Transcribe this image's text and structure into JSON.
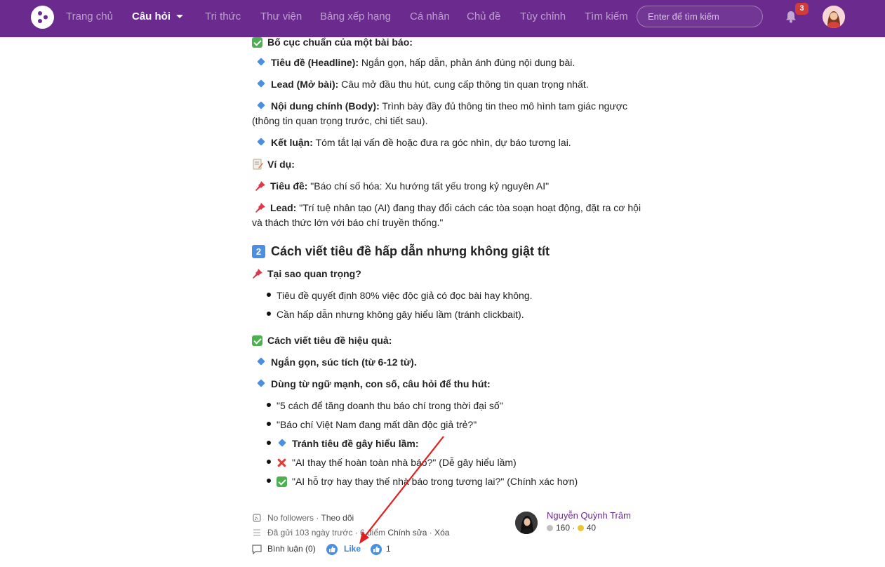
{
  "nav": {
    "items": [
      "Trang chủ",
      "Câu hỏi",
      "Tri thức",
      "Thư viện",
      "Bảng xếp hạng",
      "Cá nhân",
      "Chủ đề",
      "Tùy chỉnh",
      "Tìm kiếm"
    ],
    "active": "Câu hỏi",
    "search_placeholder": "Enter để tìm kiếm",
    "notification_count": "3"
  },
  "article": {
    "structure_heading": "Bố cục chuẩn của một bài báo:",
    "structure_items": [
      {
        "label": "Tiêu đề (Headline):",
        "text": " Ngắn gọn, hấp dẫn, phản ánh đúng nội dung bài."
      },
      {
        "label": "Lead (Mở bài):",
        "text": " Câu mở đầu thu hút, cung cấp thông tin quan trọng nhất."
      },
      {
        "label": "Nội dung chính (Body):",
        "text": " Trình bày đầy đủ thông tin theo mô hình tam giác ngược (thông tin quan trọng trước, chi tiết sau)."
      },
      {
        "label": "Kết luận:",
        "text": " Tóm tắt lại vấn đề hoặc đưa ra góc nhìn, dự báo tương lai."
      }
    ],
    "example_heading": "Ví dụ:",
    "example_items": [
      {
        "label": "Tiêu đề:",
        "text": " \"Báo chí số hóa: Xu hướng tất yếu trong kỷ nguyên AI\""
      },
      {
        "label": "Lead:",
        "text": " \"Trí tuệ nhân tạo (AI) đang thay đổi cách các tòa soạn hoạt động, đặt ra cơ hội và thách thức lớn với báo chí truyền thống.\""
      }
    ],
    "section2_number": "2",
    "section2_title": "Cách viết tiêu đề hấp dẫn nhưng không giật tít",
    "why_heading": "Tại sao quan trọng?",
    "why_items": [
      "Tiêu đề quyết định 80% việc độc giả có đọc bài hay không.",
      "Cần hấp dẫn nhưng không gây hiểu lầm (tránh clickbait)."
    ],
    "how_heading": "Cách viết tiêu đề hiệu quả:",
    "how_items": [
      "Ngắn gọn, súc tích (từ 6-12 từ).",
      "Dùng từ ngữ mạnh, con số, câu hỏi để thu hút:"
    ],
    "example_titles": [
      "\"5 cách để tăng doanh thu báo chí trong thời đại số\"",
      "\"Báo chí Việt Nam đang mất dần độc giả trẻ?\""
    ],
    "avoid_heading": "Tránh tiêu đề gây hiểu lầm:",
    "bad_example": "\"AI thay thế hoàn toàn nhà báo?\" (Dễ gây hiểu lầm)",
    "good_example": "\"AI hỗ trợ hay thay thế nhà báo trong tương lai?\" (Chính xác hơn)"
  },
  "footer": {
    "followers": "No followers",
    "follow_link": "Theo dõi",
    "posted": "Đã gửi 103 ngày trước",
    "points": "6 điểm",
    "edit": "Chính sửa",
    "delete": "Xóa",
    "comments": "Bình luận (0)",
    "like": "Like",
    "like_count": "1",
    "author_name": "Nguyễn Quỳnh Trâm",
    "author_silver": "160",
    "author_gold": "40",
    "silver_color": "#c0c0c0",
    "gold_color": "#e8c531"
  },
  "colors": {
    "nav_bg": "#6a2a8e",
    "accent_blue": "#4b8fe2",
    "arrow_red": "#e02020"
  }
}
